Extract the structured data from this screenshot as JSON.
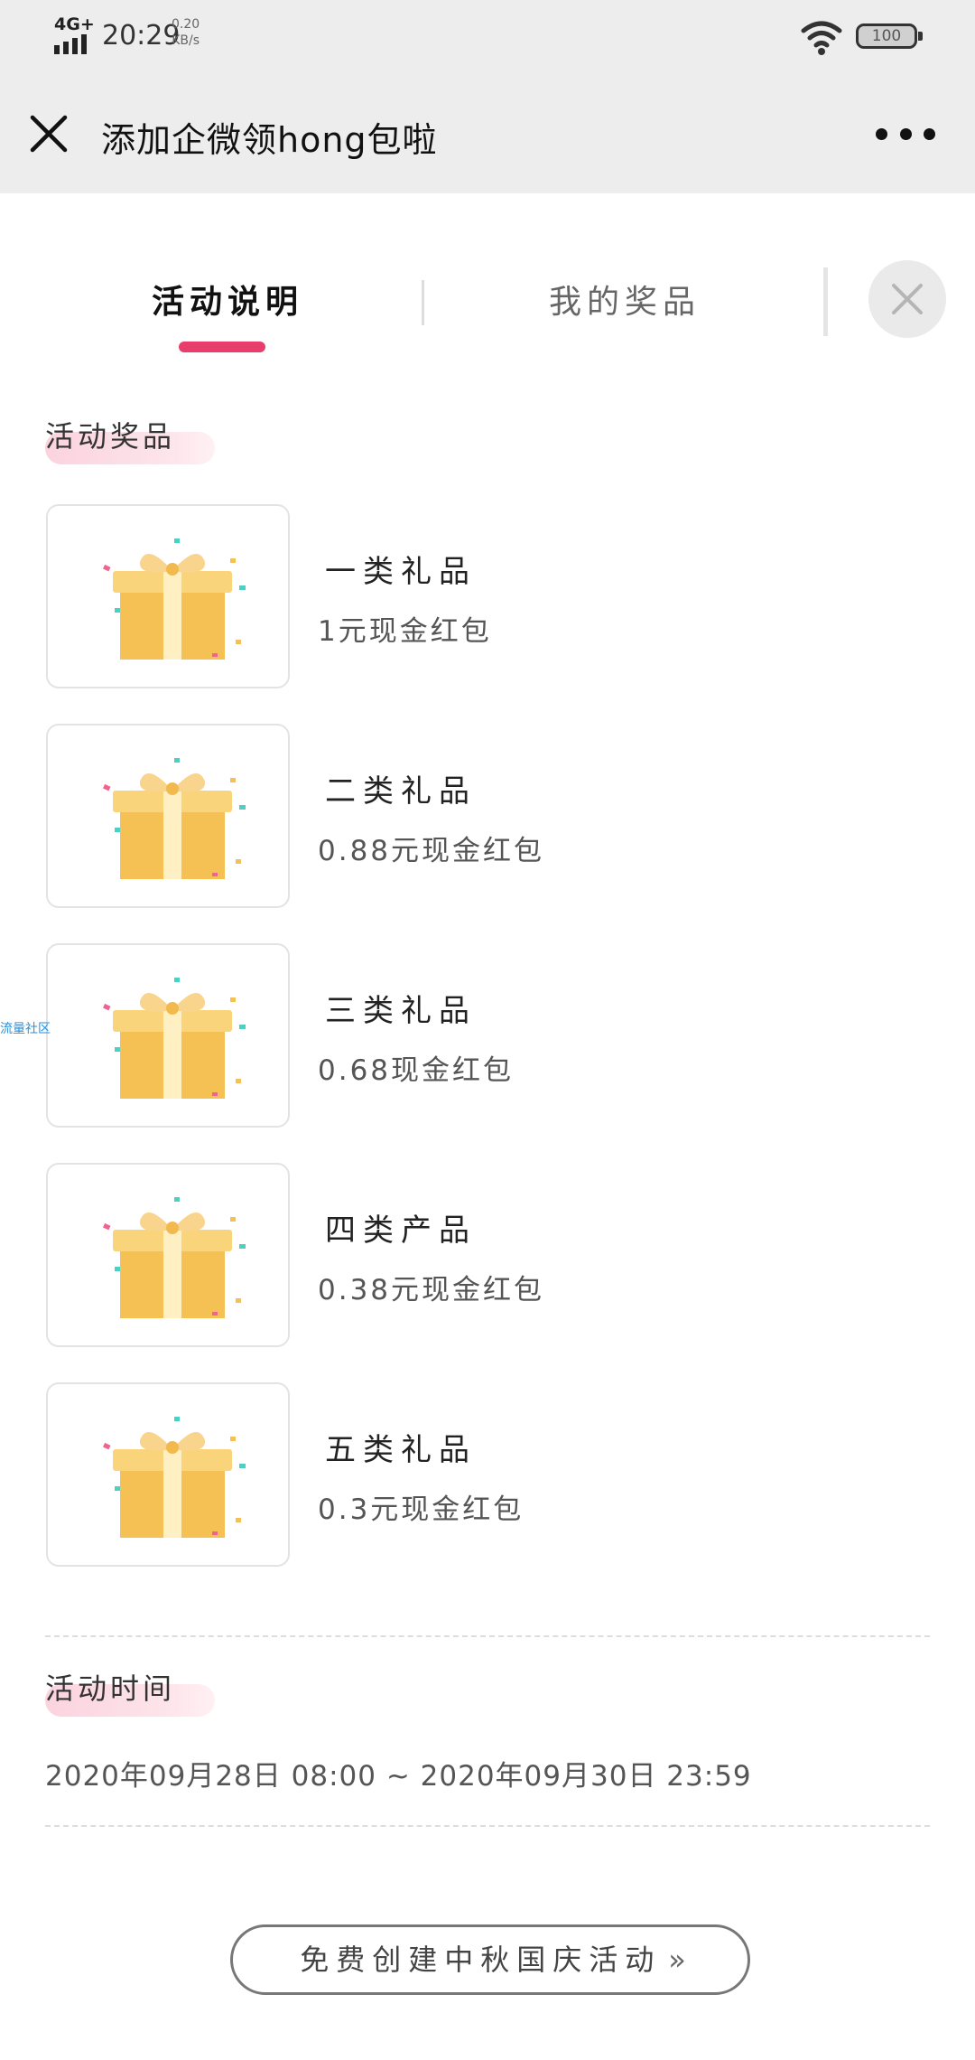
{
  "status_bar": {
    "network": "4G+",
    "time": "20:29",
    "speed_value": "0.20",
    "speed_unit": "KB/s",
    "battery": "100"
  },
  "nav": {
    "title": "添加企微领hong包啦"
  },
  "tabs": [
    {
      "label": "活动说明",
      "active": true
    },
    {
      "label": "我的奖品",
      "active": false
    }
  ],
  "prizes_section": {
    "title": "活动奖品"
  },
  "prizes": [
    {
      "name": "一类礼品",
      "desc": "1元现金红包"
    },
    {
      "name": "二类礼品",
      "desc": "0.88元现金红包"
    },
    {
      "name": "三类礼品",
      "desc": "0.68现金红包"
    },
    {
      "name": "四类产品",
      "desc": "0.38元现金红包"
    },
    {
      "name": "五类礼品",
      "desc": "0.3元现金红包"
    }
  ],
  "side_tag": "流量社区",
  "time_section": {
    "title": "活动时间",
    "range": "2020年09月28日 08:00 ~ 2020年09月30日 23:59"
  },
  "cta": {
    "label": "免费创建中秋国庆活动",
    "chevron": "»"
  },
  "colors": {
    "accent": "#e83e6c",
    "header_bg": "#ededed",
    "gift_box": "#f7c85a"
  }
}
